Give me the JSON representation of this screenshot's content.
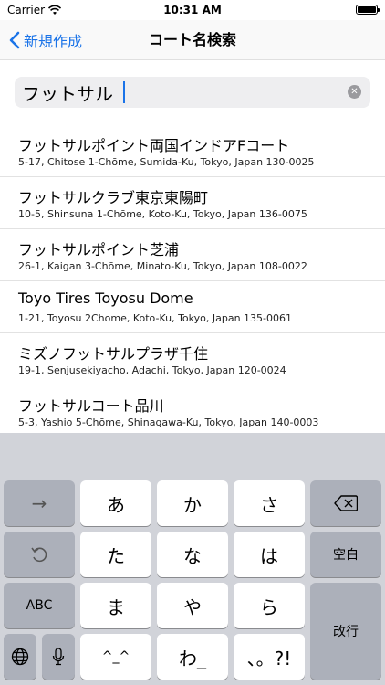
{
  "status_bar": {
    "carrier": "Carrier",
    "time": "10:31 AM"
  },
  "nav": {
    "back_label": "新規作成",
    "title": "コート名検索"
  },
  "search": {
    "value": "フットサル"
  },
  "results": [
    {
      "name": "フットサルポイント両国インドアFコート",
      "address": "5-17, Chitose 1-Chōme, Sumida-Ku, Tokyo, Japan 130-0025"
    },
    {
      "name": "フットサルクラブ東京東陽町",
      "address": "10-5, Shinsuna 1-Chōme, Koto-Ku, Tokyo, Japan 136-0075"
    },
    {
      "name": "フットサルポイント芝浦",
      "address": "26-1, Kaigan 3-Chōme, Minato-Ku, Tokyo, Japan 108-0022"
    },
    {
      "name": "Toyo Tires Toyosu Dome",
      "address": "1-21, Toyosu 2Chome, Koto-Ku, Tokyo, Japan 135-0061"
    },
    {
      "name": "ミズノフットサルプラザ千住",
      "address": "19-1, Senjusekiyacho, Adachi, Tokyo, Japan 120-0024"
    },
    {
      "name": "フットサルコート品川",
      "address": "5-3, Yashio 5-Chōme, Shinagawa-Ku, Tokyo, Japan 140-0003"
    }
  ],
  "keyboard": {
    "arrow": "→",
    "a": "あ",
    "ka": "か",
    "sa": "さ",
    "ta": "た",
    "na": "な",
    "ha": "は",
    "abc": "ABC",
    "ma": "ま",
    "ya": "や",
    "ra": "ら",
    "emoticon": "^_^",
    "wa": "わ_",
    "punct": "、。?!",
    "space": "空白",
    "return": "改行"
  },
  "colors": {
    "accent": "#1a73e8",
    "keyboard_bg": "#d1d3d9",
    "key_gray": "#acb0ba"
  }
}
